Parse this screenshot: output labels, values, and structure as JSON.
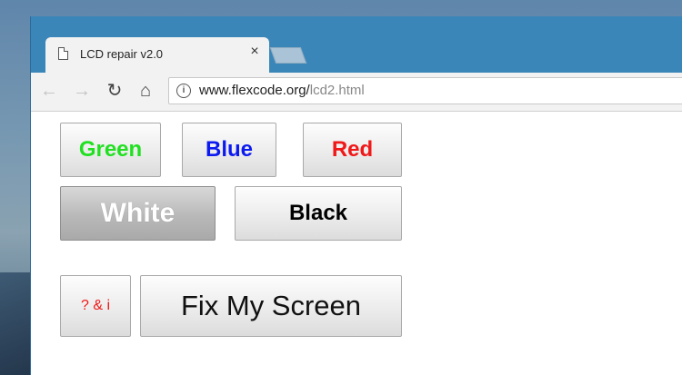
{
  "browser": {
    "tab_title": "LCD repair v2.0",
    "tab_close": "×",
    "url_host": "www.flexcode.org/",
    "url_path": "lcd2.html",
    "nav": {
      "back": "←",
      "forward": "→",
      "reload": "↻",
      "home": "⌂",
      "info": "i"
    }
  },
  "buttons": {
    "green": "Green",
    "blue": "Blue",
    "red": "Red",
    "white": "White",
    "black": "Black",
    "help": "? & i",
    "fix": "Fix My Screen"
  },
  "colors": {
    "green": "#21e021",
    "blue": "#0c1af0",
    "red": "#f01818",
    "titlebar": "#3b86b9"
  }
}
